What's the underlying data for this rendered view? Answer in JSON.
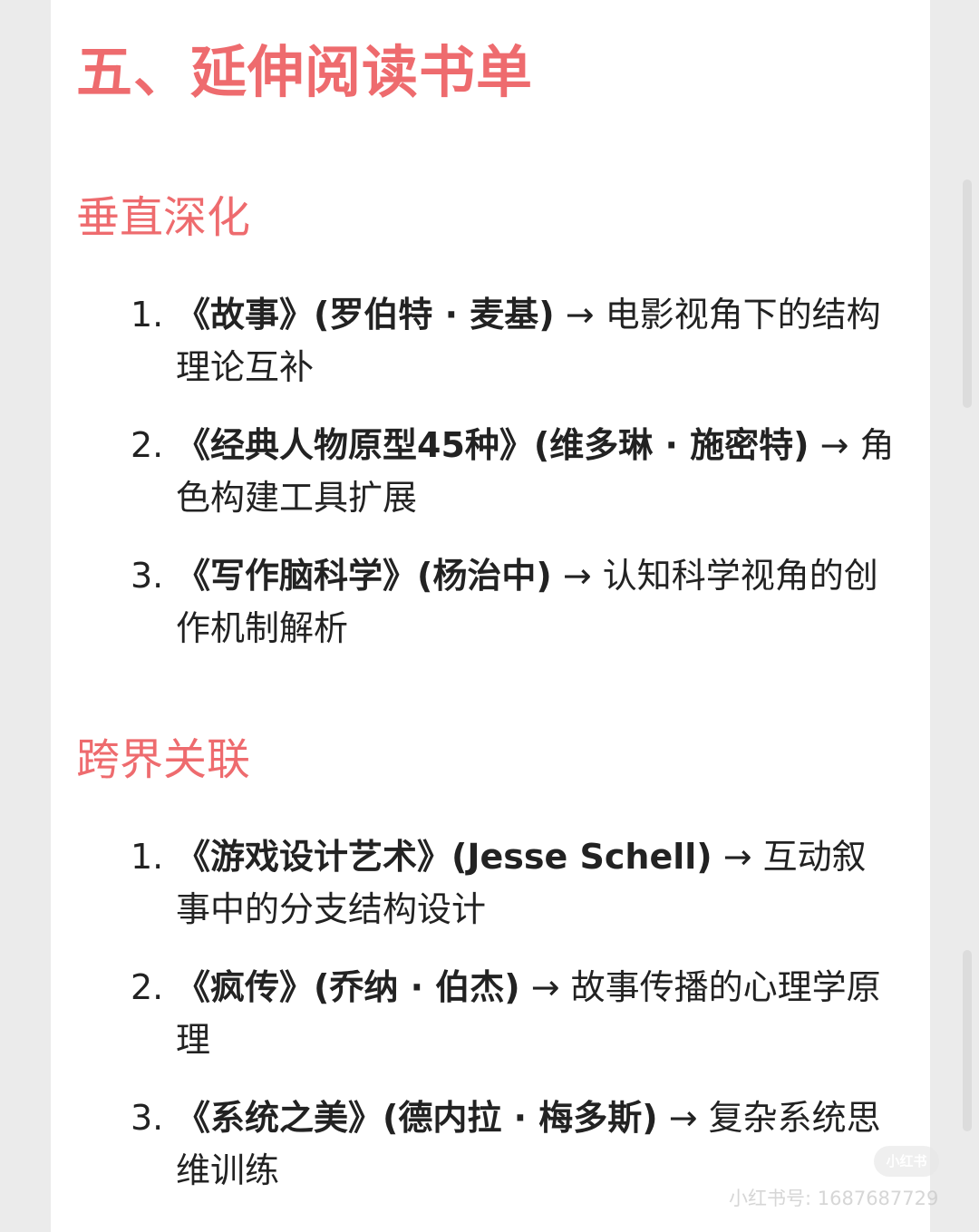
{
  "theme": {
    "accent": "#ee6b6e",
    "text": "#222222"
  },
  "heading": "五、延伸阅读书单",
  "sections": [
    {
      "title": "垂直深化",
      "items": [
        {
          "num": "1.",
          "book": "《故事》(罗伯特 · 麦基)",
          "desc": "→ 电影视角下的结构理论互补"
        },
        {
          "num": "2.",
          "book": "《经典人物原型45种》(维多琳 · 施密特)",
          "desc": "→ 角色构建工具扩展"
        },
        {
          "num": "3.",
          "book": "《写作脑科学》(杨治中)",
          "desc": "→ 认知科学视角的创作机制解析"
        }
      ]
    },
    {
      "title": "跨界关联",
      "items": [
        {
          "num": "1.",
          "book": "《游戏设计艺术》(Jesse Schell)",
          "desc": "→ 互动叙事中的分支结构设计"
        },
        {
          "num": "2.",
          "book": "《疯传》(乔纳 · 伯杰)",
          "desc": "→ 故事传播的心理学原理"
        },
        {
          "num": "3.",
          "book": "《系统之美》(德内拉 · 梅多斯)",
          "desc": "→ 复杂系统思维训练"
        }
      ]
    }
  ],
  "watermark": {
    "badge": "小红书",
    "id_text": "小红书号: 1687687729"
  }
}
